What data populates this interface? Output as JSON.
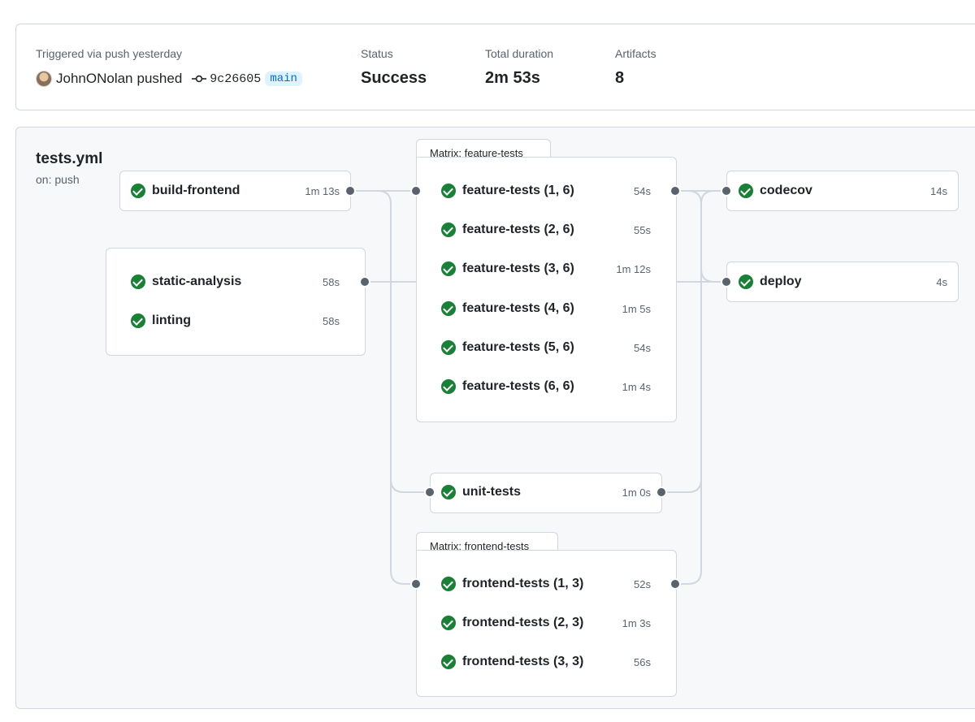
{
  "summary": {
    "trigger_label": "Triggered via push yesterday",
    "actor": "JohnONolan",
    "verb": "pushed",
    "commit": "9c26605",
    "branch": "main",
    "status_label": "Status",
    "status_value": "Success",
    "duration_label": "Total duration",
    "duration_value": "2m 53s",
    "artifacts_label": "Artifacts",
    "artifacts_value": "8"
  },
  "workflow": {
    "file": "tests.yml",
    "trigger": "on: push"
  },
  "jobs": {
    "build_frontend": {
      "name": "build-frontend",
      "duration": "1m 13s"
    },
    "static_analysis": {
      "name": "static-analysis",
      "duration": "58s"
    },
    "linting": {
      "name": "linting",
      "duration": "58s"
    },
    "feature_matrix": {
      "label": "Matrix: feature-tests",
      "items": [
        {
          "name": "feature-tests (1, 6)",
          "duration": "54s"
        },
        {
          "name": "feature-tests (2, 6)",
          "duration": "55s"
        },
        {
          "name": "feature-tests (3, 6)",
          "duration": "1m 12s"
        },
        {
          "name": "feature-tests (4, 6)",
          "duration": "1m 5s"
        },
        {
          "name": "feature-tests (5, 6)",
          "duration": "54s"
        },
        {
          "name": "feature-tests (6, 6)",
          "duration": "1m 4s"
        }
      ]
    },
    "unit_tests": {
      "name": "unit-tests",
      "duration": "1m 0s"
    },
    "frontend_matrix": {
      "label": "Matrix: frontend-tests",
      "items": [
        {
          "name": "frontend-tests (1, 3)",
          "duration": "52s"
        },
        {
          "name": "frontend-tests (2, 3)",
          "duration": "1m 3s"
        },
        {
          "name": "frontend-tests (3, 3)",
          "duration": "56s"
        }
      ]
    },
    "codecov": {
      "name": "codecov",
      "duration": "14s"
    },
    "deploy": {
      "name": "deploy",
      "duration": "4s"
    }
  },
  "colors": {
    "success": "#1a7f37",
    "link": "#d0d7de",
    "branch_bg": "#ddf4ff",
    "branch_fg": "#0969da"
  }
}
